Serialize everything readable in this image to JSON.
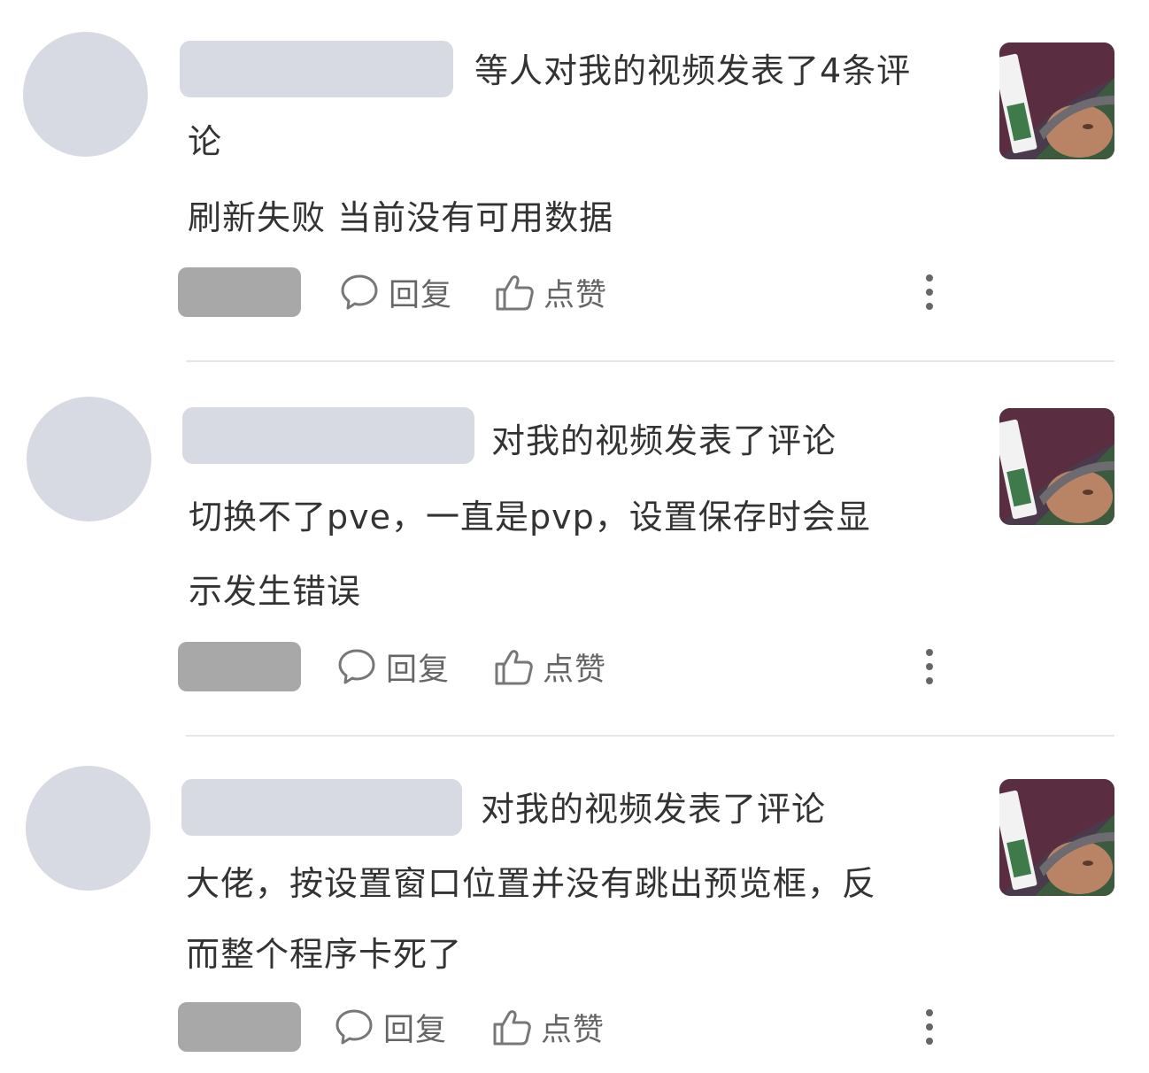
{
  "actions": {
    "reply_label": "回复",
    "like_label": "点赞"
  },
  "icons": {
    "reply": "comment-bubble-icon",
    "like": "thumbs-up-icon",
    "more": "more-vertical-icon"
  },
  "notifications": [
    {
      "header_line1": "等人对我的视频发表了4条评",
      "header_line2": "论",
      "comment_line1": "刷新失败 当前没有可用数据",
      "comment_line2": ""
    },
    {
      "header_line1": "对我的视频发表了评论",
      "header_line2": "",
      "comment_line1": "切换不了pve，一直是pvp，设置保存时会显",
      "comment_line2": "示发生错误"
    },
    {
      "header_line1": "对我的视频发表了评论",
      "header_line2": "",
      "comment_line1": "大佬，按设置窗口位置并没有跳出预览框，反",
      "comment_line2": "而整个程序卡死了"
    }
  ]
}
